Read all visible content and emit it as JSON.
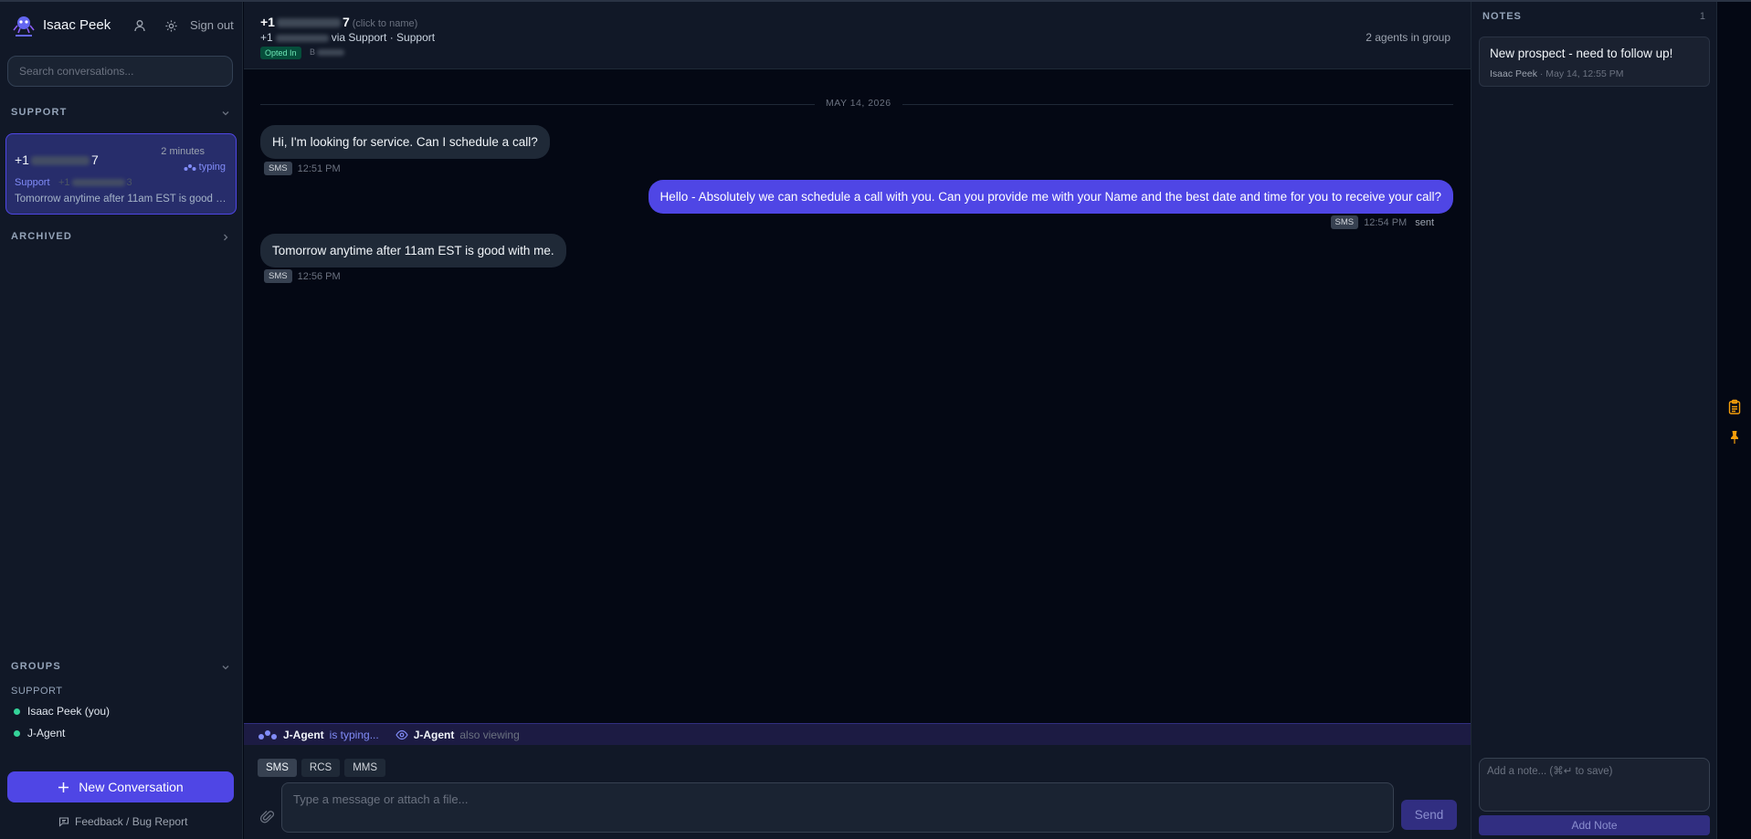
{
  "sidebar": {
    "user_name": "Isaac Peek",
    "sign_out": "Sign out",
    "search_placeholder": "Search conversations...",
    "support_section": "SUPPORT",
    "archived_section": "ARCHIVED",
    "conversation": {
      "phone_prefix": "+1",
      "phone_suffix": "7",
      "time": "2 minutes",
      "typing": "typing",
      "group": "Support",
      "group_number": "+1",
      "group_number_suffix": "3",
      "preview": "Tomorrow anytime after 11am EST is good with me."
    },
    "groups_section": "GROUPS",
    "groups_sub": "SUPPORT",
    "members": [
      "Isaac Peek (you)",
      "J-Agent"
    ],
    "new_conversation": "New Conversation",
    "feedback": "Feedback / Bug Report"
  },
  "chat": {
    "phone_prefix": "+1",
    "phone_suffix": "7",
    "click_to_name": "(click to name)",
    "via_prefix": "+1",
    "via_text": "via Support · Support",
    "opted_in": "Opted In",
    "opted_extra": "B",
    "agents_in_group": "2 agents in group",
    "date_separator": "MAY 14, 2026",
    "messages": [
      {
        "direction": "in",
        "text": "Hi, I'm looking for service. Can I schedule a call?",
        "channel": "SMS",
        "time": "12:51 PM",
        "status": ""
      },
      {
        "direction": "out",
        "text": "Hello - Absolutely we can schedule a call with you. Can you provide me with your Name and the best date and time for you to receive your call?",
        "channel": "SMS",
        "time": "12:54 PM",
        "status": "sent"
      },
      {
        "direction": "in",
        "text": "Tomorrow anytime after 11am EST is good with me.",
        "channel": "SMS",
        "time": "12:56 PM",
        "status": ""
      }
    ],
    "typing_agent": "J-Agent",
    "typing_text": "is typing...",
    "viewing_agent": "J-Agent",
    "viewing_text": "also viewing",
    "modes": [
      "SMS",
      "RCS",
      "MMS"
    ],
    "active_mode": "SMS",
    "input_placeholder": "Type a message or attach a file...",
    "send": "Send"
  },
  "notes": {
    "title": "NOTES",
    "count": "1",
    "items": [
      {
        "text": "New prospect - need to follow up!",
        "author": "Isaac Peek",
        "date": "May 14, 12:55 PM"
      }
    ],
    "input_placeholder": "Add a note... (⌘↵ to save)",
    "add_button": "Add Note"
  },
  "colors": {
    "accent": "#4f46e5",
    "online": "#34d399",
    "rail_icon": "#f59e0b"
  }
}
